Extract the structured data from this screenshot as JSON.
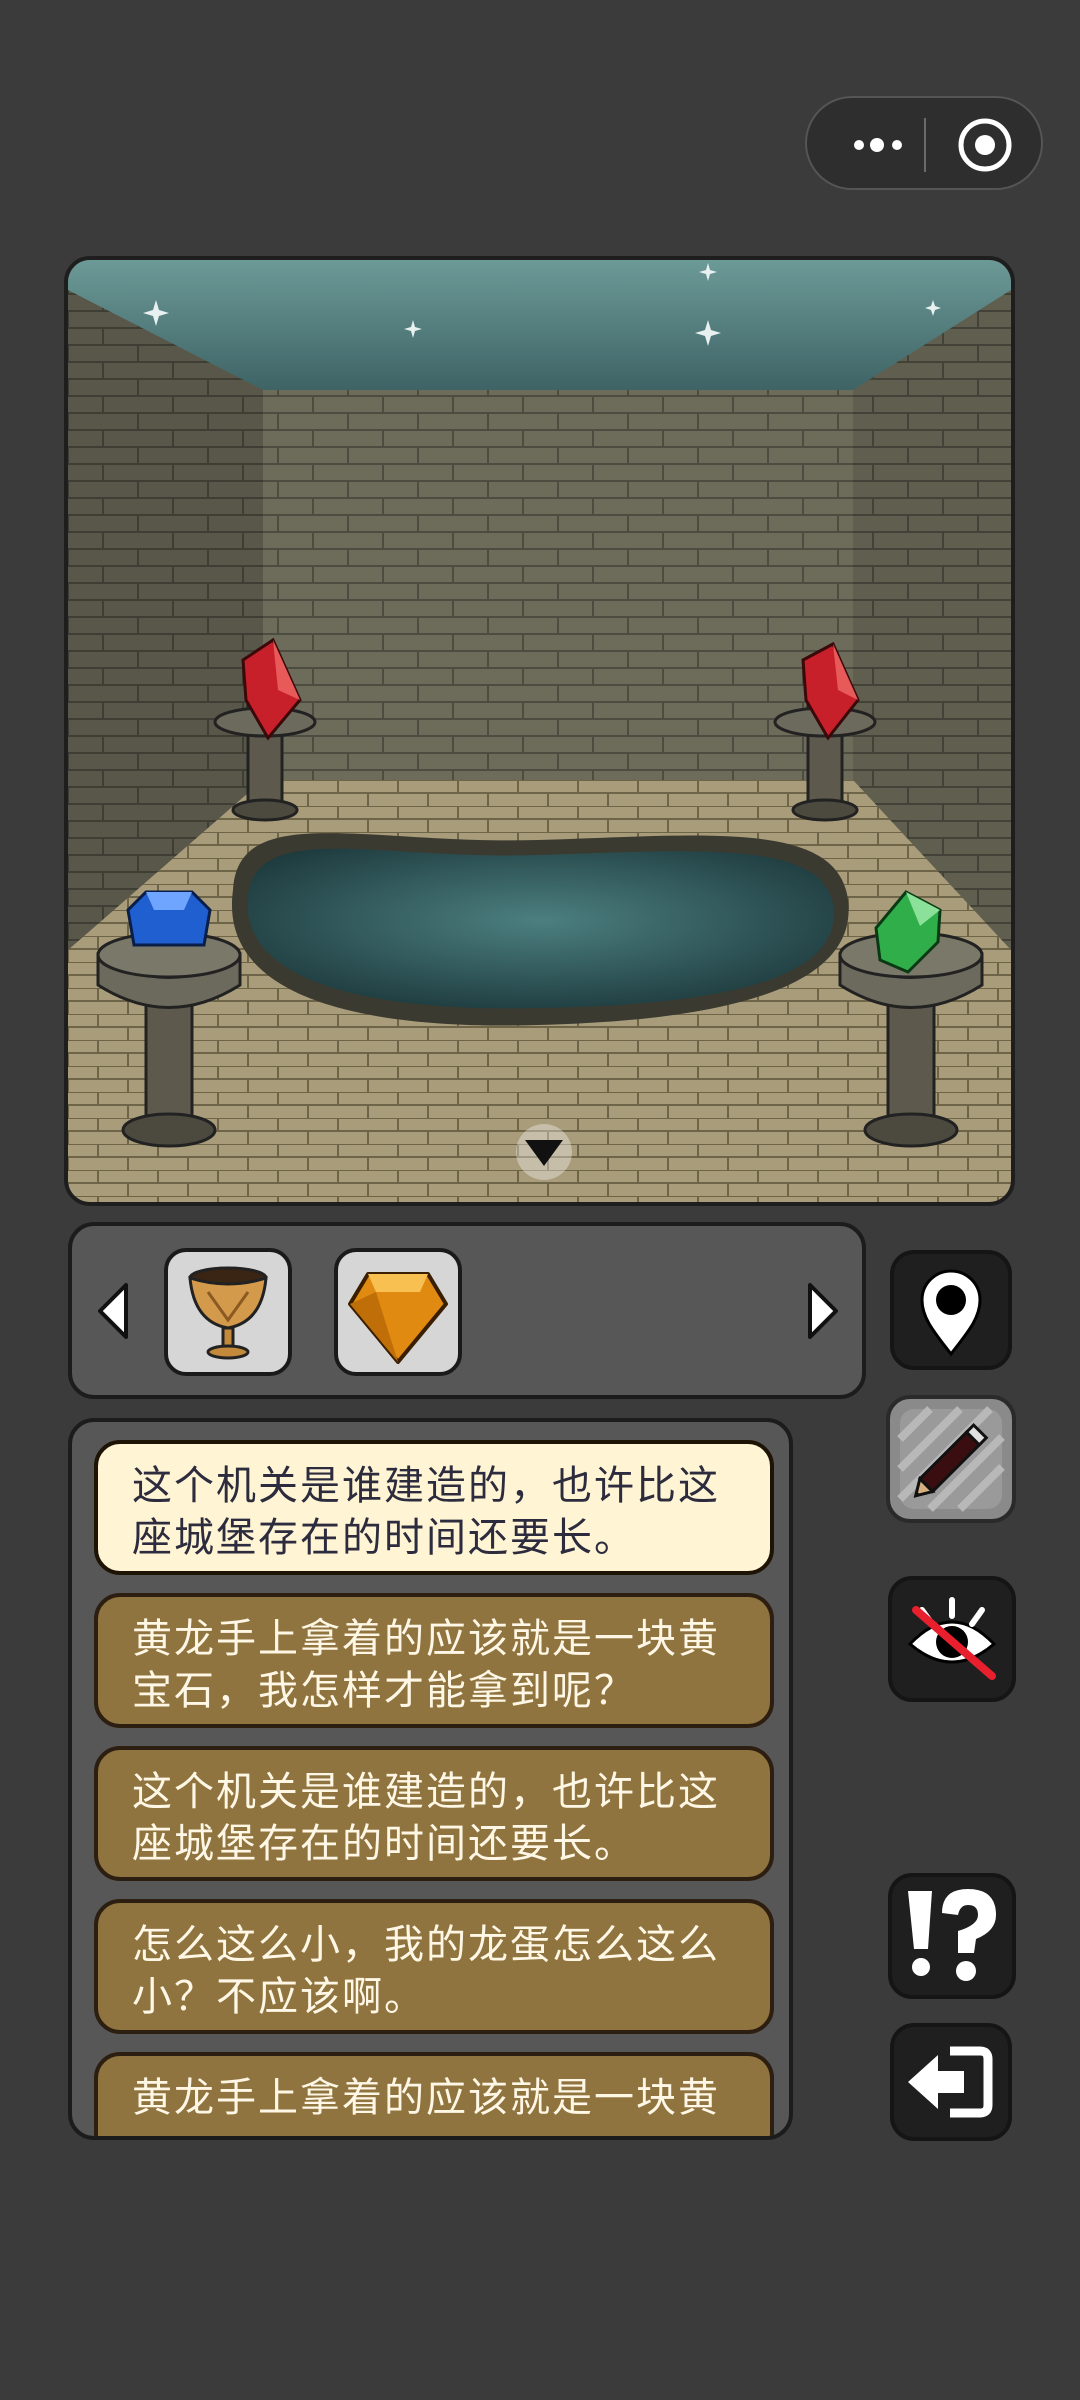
{
  "capsule": {
    "more_icon": "more-dots-icon",
    "close_icon": "target-circle-icon"
  },
  "scene": {
    "name": "castle-pool-room",
    "gems": [
      "red",
      "red",
      "blue",
      "green"
    ],
    "nav_icon": "triangle-down-icon"
  },
  "inventory": {
    "items": [
      {
        "icon": "golden-chalice-icon"
      },
      {
        "icon": "amber-gem-icon"
      }
    ],
    "prev_icon": "triangle-left-icon",
    "next_icon": "triangle-right-icon"
  },
  "hints": [
    {
      "line1": "这个机关是谁建造的，也许比这",
      "line2": "座城堡存在的时间还要长。",
      "active": true
    },
    {
      "line1": "黄龙手上拿着的应该就是一块黄",
      "line2": "宝石，我怎样才能拿到呢？",
      "active": false
    },
    {
      "line1": "这个机关是谁建造的，也许比这",
      "line2": "座城堡存在的时间还要长。",
      "active": false
    },
    {
      "line1": "怎么这么小，我的龙蛋怎么这么",
      "line2": "小？不应该啊。",
      "active": false
    },
    {
      "line1": "黄龙手上拿着的应该就是一块黄",
      "line2": "",
      "active": false
    }
  ],
  "side_buttons": [
    "map-pin-icon",
    "pencil-icon",
    "hide-eye-icon",
    "hint-question-icon",
    "exit-arrow-icon"
  ],
  "colors": {
    "background": "#3b3b3b",
    "hint_bg": "#90743f",
    "hint_active_bg": "#fff5d4"
  }
}
